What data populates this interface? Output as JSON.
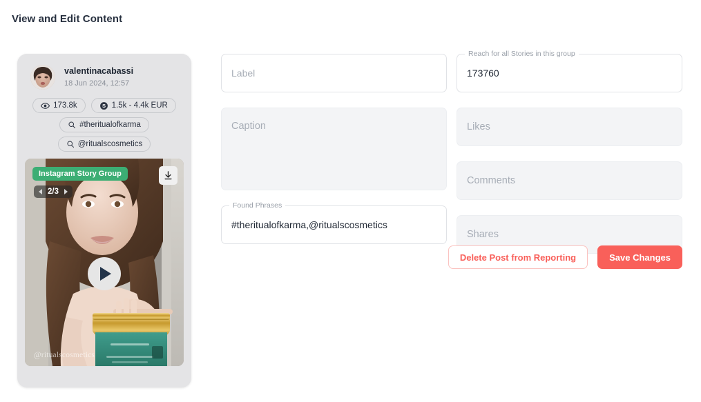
{
  "page": {
    "title": "View and Edit Content"
  },
  "post_card": {
    "avatar_icon": "user-avatar-image",
    "handle": "valentinacabassi",
    "posted_at": "18 Jun 2024, 12:57",
    "chips": [
      {
        "icon": "eye-icon",
        "label": "173.8k"
      },
      {
        "icon": "dollar-circle-icon",
        "label": "1.5k - 4.4k EUR"
      },
      {
        "icon": "search-icon",
        "label": "#theritualofkarma"
      },
      {
        "icon": "search-icon",
        "label": "@ritualscosmetics"
      }
    ],
    "media": {
      "badge": "Instagram Story Group",
      "badge_color": "#3cae74",
      "pager_count": "2/3",
      "prev_icon": "chevron-left-icon",
      "next_icon": "chevron-right-icon",
      "download_icon": "download-icon",
      "play_icon": "play-icon",
      "watermark": "@ritualscosmetics"
    }
  },
  "form": {
    "left": [
      {
        "name": "label",
        "variant": "outline",
        "size": "small",
        "legend": "",
        "placeholder": "Label",
        "value": ""
      },
      {
        "name": "caption",
        "variant": "filled",
        "size": "large",
        "legend": "",
        "placeholder": "Caption",
        "value": ""
      },
      {
        "name": "found-phrases",
        "variant": "outline",
        "size": "small",
        "legend": "Found Phrases",
        "placeholder": "",
        "value": "#theritualofkarma,@ritualscosmetics"
      }
    ],
    "right": [
      {
        "name": "reach",
        "variant": "outline",
        "size": "small",
        "legend": "Reach for all Stories in this group",
        "placeholder": "",
        "value": "173760"
      },
      {
        "name": "likes",
        "variant": "filled",
        "size": "small",
        "legend": "",
        "placeholder": "Likes",
        "value": ""
      },
      {
        "name": "comments",
        "variant": "filled",
        "size": "small",
        "legend": "",
        "placeholder": "Comments",
        "value": ""
      },
      {
        "name": "shares",
        "variant": "filled",
        "size": "small",
        "legend": "",
        "placeholder": "Shares",
        "value": ""
      }
    ],
    "actions": {
      "delete_label": "Delete Post from Reporting",
      "save_label": "Save Changes",
      "accent_color": "#f9605a"
    }
  }
}
